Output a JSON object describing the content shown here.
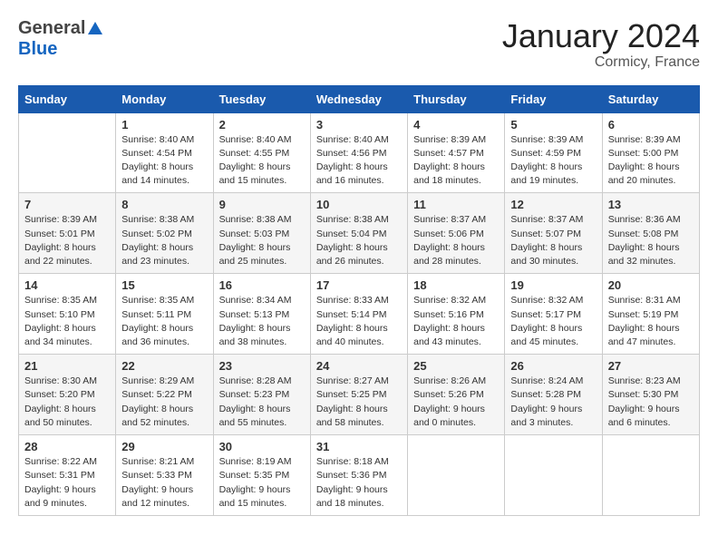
{
  "logo": {
    "general": "General",
    "blue": "Blue"
  },
  "title": {
    "month_year": "January 2024",
    "location": "Cormicy, France"
  },
  "calendar": {
    "headers": [
      "Sunday",
      "Monday",
      "Tuesday",
      "Wednesday",
      "Thursday",
      "Friday",
      "Saturday"
    ],
    "rows": [
      [
        {
          "day": "",
          "info": ""
        },
        {
          "day": "1",
          "info": "Sunrise: 8:40 AM\nSunset: 4:54 PM\nDaylight: 8 hours\nand 14 minutes."
        },
        {
          "day": "2",
          "info": "Sunrise: 8:40 AM\nSunset: 4:55 PM\nDaylight: 8 hours\nand 15 minutes."
        },
        {
          "day": "3",
          "info": "Sunrise: 8:40 AM\nSunset: 4:56 PM\nDaylight: 8 hours\nand 16 minutes."
        },
        {
          "day": "4",
          "info": "Sunrise: 8:39 AM\nSunset: 4:57 PM\nDaylight: 8 hours\nand 18 minutes."
        },
        {
          "day": "5",
          "info": "Sunrise: 8:39 AM\nSunset: 4:59 PM\nDaylight: 8 hours\nand 19 minutes."
        },
        {
          "day": "6",
          "info": "Sunrise: 8:39 AM\nSunset: 5:00 PM\nDaylight: 8 hours\nand 20 minutes."
        }
      ],
      [
        {
          "day": "7",
          "info": "Sunrise: 8:39 AM\nSunset: 5:01 PM\nDaylight: 8 hours\nand 22 minutes."
        },
        {
          "day": "8",
          "info": "Sunrise: 8:38 AM\nSunset: 5:02 PM\nDaylight: 8 hours\nand 23 minutes."
        },
        {
          "day": "9",
          "info": "Sunrise: 8:38 AM\nSunset: 5:03 PM\nDaylight: 8 hours\nand 25 minutes."
        },
        {
          "day": "10",
          "info": "Sunrise: 8:38 AM\nSunset: 5:04 PM\nDaylight: 8 hours\nand 26 minutes."
        },
        {
          "day": "11",
          "info": "Sunrise: 8:37 AM\nSunset: 5:06 PM\nDaylight: 8 hours\nand 28 minutes."
        },
        {
          "day": "12",
          "info": "Sunrise: 8:37 AM\nSunset: 5:07 PM\nDaylight: 8 hours\nand 30 minutes."
        },
        {
          "day": "13",
          "info": "Sunrise: 8:36 AM\nSunset: 5:08 PM\nDaylight: 8 hours\nand 32 minutes."
        }
      ],
      [
        {
          "day": "14",
          "info": "Sunrise: 8:35 AM\nSunset: 5:10 PM\nDaylight: 8 hours\nand 34 minutes."
        },
        {
          "day": "15",
          "info": "Sunrise: 8:35 AM\nSunset: 5:11 PM\nDaylight: 8 hours\nand 36 minutes."
        },
        {
          "day": "16",
          "info": "Sunrise: 8:34 AM\nSunset: 5:13 PM\nDaylight: 8 hours\nand 38 minutes."
        },
        {
          "day": "17",
          "info": "Sunrise: 8:33 AM\nSunset: 5:14 PM\nDaylight: 8 hours\nand 40 minutes."
        },
        {
          "day": "18",
          "info": "Sunrise: 8:32 AM\nSunset: 5:16 PM\nDaylight: 8 hours\nand 43 minutes."
        },
        {
          "day": "19",
          "info": "Sunrise: 8:32 AM\nSunset: 5:17 PM\nDaylight: 8 hours\nand 45 minutes."
        },
        {
          "day": "20",
          "info": "Sunrise: 8:31 AM\nSunset: 5:19 PM\nDaylight: 8 hours\nand 47 minutes."
        }
      ],
      [
        {
          "day": "21",
          "info": "Sunrise: 8:30 AM\nSunset: 5:20 PM\nDaylight: 8 hours\nand 50 minutes."
        },
        {
          "day": "22",
          "info": "Sunrise: 8:29 AM\nSunset: 5:22 PM\nDaylight: 8 hours\nand 52 minutes."
        },
        {
          "day": "23",
          "info": "Sunrise: 8:28 AM\nSunset: 5:23 PM\nDaylight: 8 hours\nand 55 minutes."
        },
        {
          "day": "24",
          "info": "Sunrise: 8:27 AM\nSunset: 5:25 PM\nDaylight: 8 hours\nand 58 minutes."
        },
        {
          "day": "25",
          "info": "Sunrise: 8:26 AM\nSunset: 5:26 PM\nDaylight: 9 hours\nand 0 minutes."
        },
        {
          "day": "26",
          "info": "Sunrise: 8:24 AM\nSunset: 5:28 PM\nDaylight: 9 hours\nand 3 minutes."
        },
        {
          "day": "27",
          "info": "Sunrise: 8:23 AM\nSunset: 5:30 PM\nDaylight: 9 hours\nand 6 minutes."
        }
      ],
      [
        {
          "day": "28",
          "info": "Sunrise: 8:22 AM\nSunset: 5:31 PM\nDaylight: 9 hours\nand 9 minutes."
        },
        {
          "day": "29",
          "info": "Sunrise: 8:21 AM\nSunset: 5:33 PM\nDaylight: 9 hours\nand 12 minutes."
        },
        {
          "day": "30",
          "info": "Sunrise: 8:19 AM\nSunset: 5:35 PM\nDaylight: 9 hours\nand 15 minutes."
        },
        {
          "day": "31",
          "info": "Sunrise: 8:18 AM\nSunset: 5:36 PM\nDaylight: 9 hours\nand 18 minutes."
        },
        {
          "day": "",
          "info": ""
        },
        {
          "day": "",
          "info": ""
        },
        {
          "day": "",
          "info": ""
        }
      ]
    ]
  }
}
